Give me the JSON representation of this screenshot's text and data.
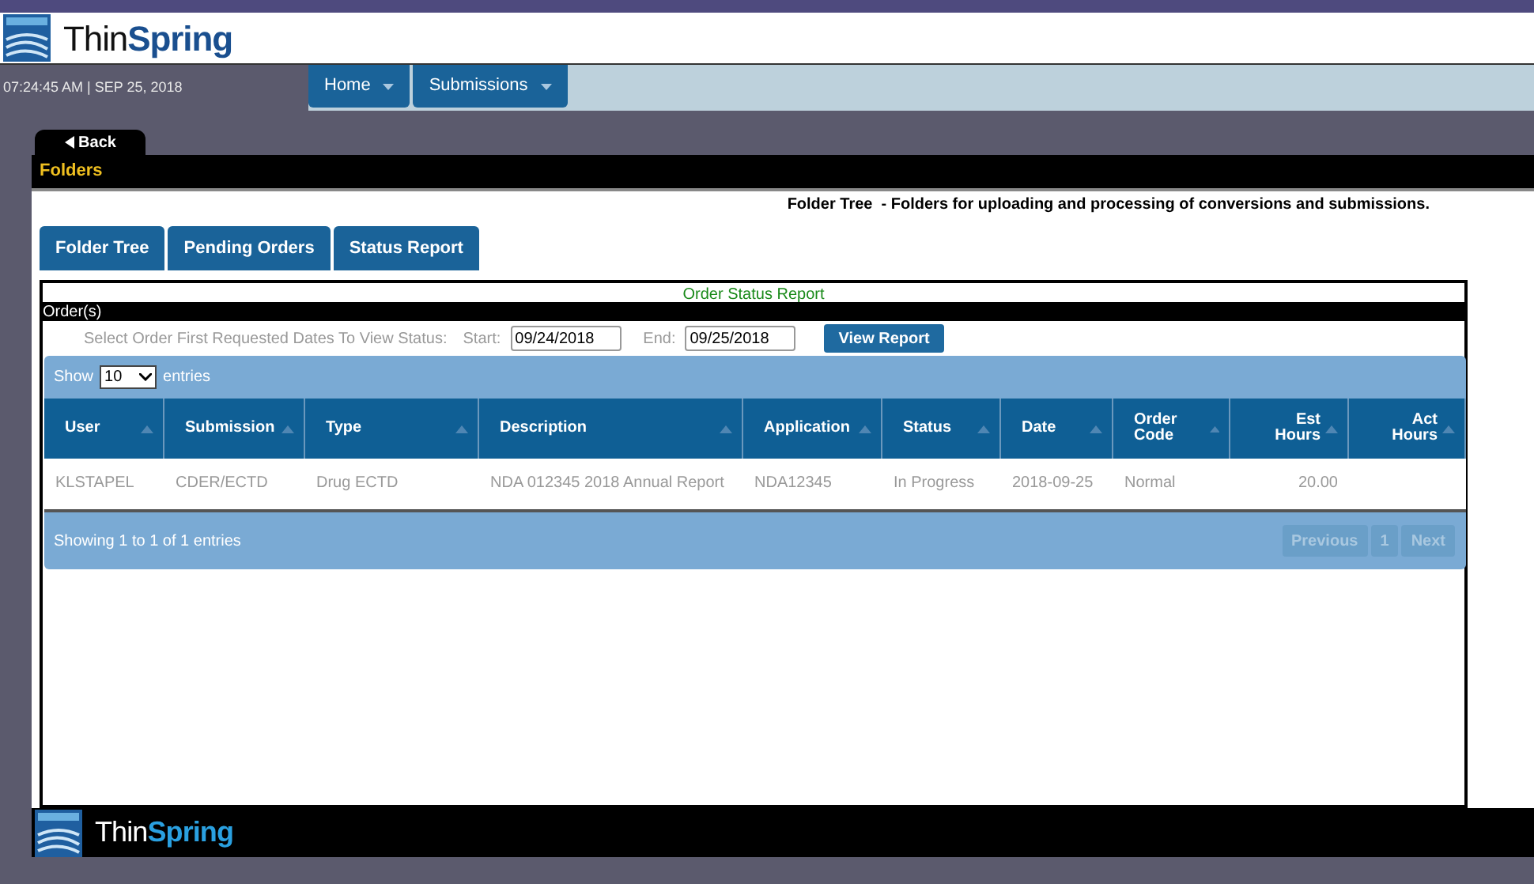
{
  "logo": {
    "parts": [
      "Thin",
      "Spring"
    ]
  },
  "clock": "07:24:45 AM | SEP 25, 2018",
  "nav": [
    {
      "label": "Home"
    },
    {
      "label": "Submissions"
    }
  ],
  "back": "Back",
  "section_title": "Folders",
  "description": "Folder Tree  - Folders for uploading and processing of conversions and submissions.",
  "tabs": [
    {
      "label": "Folder Tree"
    },
    {
      "label": "Pending Orders"
    },
    {
      "label": "Status Report"
    }
  ],
  "report": {
    "title": "Order Status Report",
    "bar": "Order(s)",
    "filter_label": "Select Order First Requested Dates To View Status:",
    "start_label": "Start:",
    "start": "09/24/2018",
    "end_label": "End:",
    "end": "09/25/2018",
    "button": "View Report"
  },
  "table": {
    "show": "Show",
    "page_size": "10",
    "entries": "entries",
    "columns": [
      {
        "label": "User"
      },
      {
        "label": "Submission"
      },
      {
        "label": "Type"
      },
      {
        "label": "Description"
      },
      {
        "label": "Application"
      },
      {
        "label": "Status"
      },
      {
        "label": "Date"
      },
      {
        "label": "Order Code"
      },
      {
        "label": "Est Hours"
      },
      {
        "label": "Act Hours"
      }
    ],
    "rows": [
      [
        "KLSTAPEL",
        "CDER/ECTD",
        "Drug ECTD",
        "NDA 012345 2018 Annual Report",
        "NDA12345",
        "In Progress",
        "2018-09-25",
        "Normal",
        "20.00",
        ""
      ]
    ],
    "info": "Showing 1 to 1 of 1 entries",
    "pager": [
      "Previous",
      "1",
      "Next"
    ]
  },
  "footer_logo": {
    "parts": [
      "Thin",
      "Spring"
    ]
  }
}
